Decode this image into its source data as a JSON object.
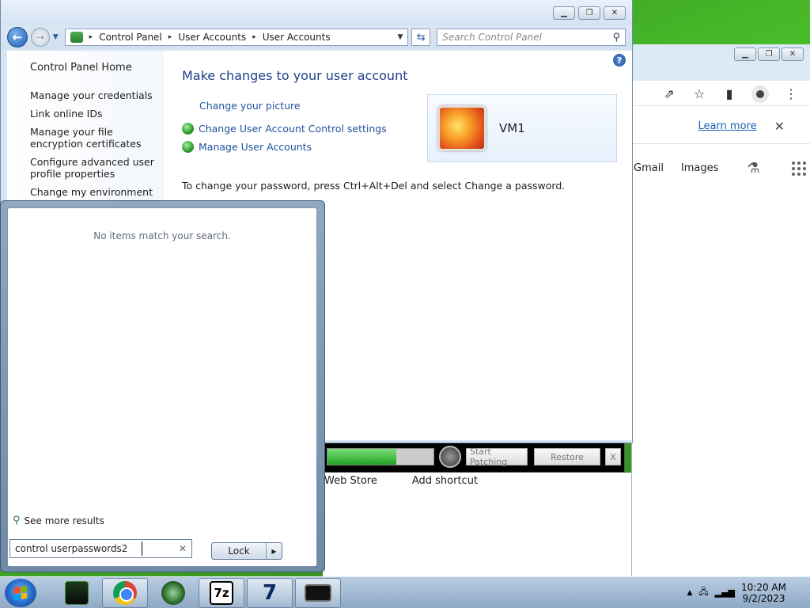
{
  "chrome": {
    "learn_more": "Learn more",
    "nav": [
      "Gmail",
      "Images"
    ],
    "shortcuts": [
      "Web Store",
      "Add shortcut"
    ]
  },
  "patcher": {
    "progress_fraction": 0.65,
    "start_label": "Start Patching",
    "restore_label": "Restore",
    "close_label": "X"
  },
  "control_panel": {
    "breadcrumb": [
      "Control Panel",
      "User Accounts",
      "User Accounts"
    ],
    "search_placeholder": "Search Control Panel",
    "sidebar": {
      "home": "Control Panel Home",
      "links": [
        "Manage your credentials",
        "Link online IDs",
        "Manage your file encryption certificates",
        "Configure advanced user profile properties",
        "Change my environment"
      ]
    },
    "heading": "Make changes to your user account",
    "links": {
      "change_picture": "Change your picture",
      "uac": "Change User Account Control settings",
      "manage": "Manage User Accounts"
    },
    "account_name": "VM1",
    "note": "To change your password, press Ctrl+Alt+Del and select Change a password."
  },
  "start_menu": {
    "no_items": "No items match your search.",
    "see_more": "See more results",
    "search_value": "control userpasswords2",
    "lock_label": "Lock"
  },
  "taskbar": {
    "time": "10:20 AM",
    "date": "9/2/2023",
    "icons": [
      "start-orb",
      "app-green-icon",
      "chrome-icon",
      "globe-icon",
      "7zip-icon",
      "7tsp-icon",
      "keyboard-app-icon"
    ]
  }
}
